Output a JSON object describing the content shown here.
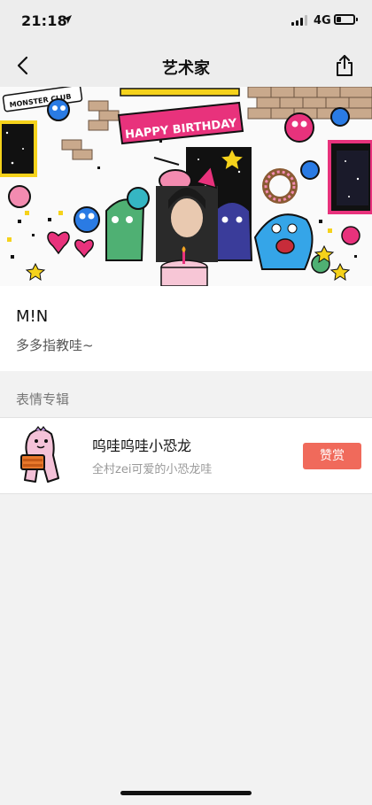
{
  "status_bar": {
    "time": "21:18",
    "network": "4G",
    "battery_level": 0.25
  },
  "nav": {
    "title": "艺术家"
  },
  "banner": {
    "heading": "HAPPY BIRTHDAY",
    "club": "MONSTER CLUB"
  },
  "artist": {
    "name": "M!N",
    "intro": "多多指教哇~"
  },
  "section": {
    "label": "表情专辑"
  },
  "album": {
    "title": "呜哇呜哇小恐龙",
    "subtitle": "全村zei可爱的小恐龙哇",
    "button_label": "赞赏"
  },
  "colors": {
    "accent": "#f06a5b",
    "background": "#f2f2f2"
  }
}
